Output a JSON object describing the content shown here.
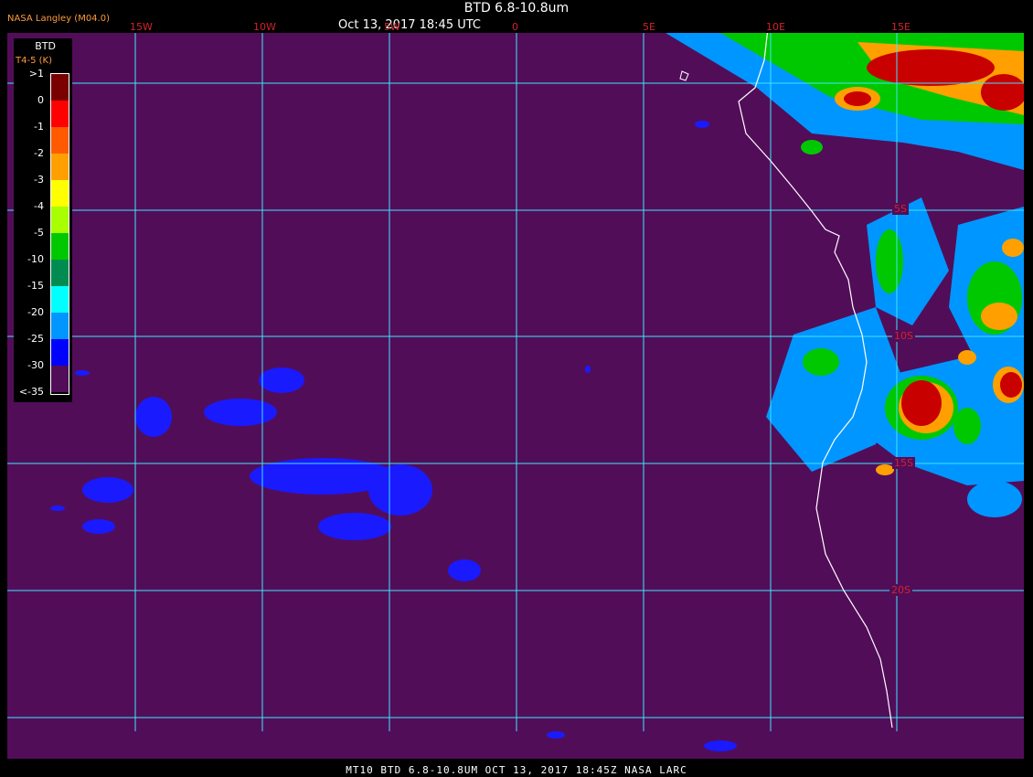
{
  "header": {
    "title": "BTD 6.8-10.8um",
    "datetime": "Oct 13, 2017 18:45 UTC",
    "organization": "NASA Langley (M04.0)"
  },
  "footer": {
    "caption": "MT10  BTD 6.8-10.8UM  OCT 13, 2017 18:45Z  NASA LARC"
  },
  "legend": {
    "title": "BTD",
    "subtitle": "T4-5 (K)",
    "ticks": [
      ">1",
      "0",
      "-1",
      "-2",
      "-3",
      "-4",
      "-5",
      "-10",
      "-15",
      "-20",
      "-25",
      "-30",
      "<-35"
    ],
    "colors": [
      "#7a0000",
      "#ff0000",
      "#ff5a00",
      "#ffa000",
      "#ffff00",
      "#a8ff00",
      "#00c800",
      "#008c50",
      "#00ffff",
      "#0096ff",
      "#0000ff",
      "#520d59"
    ]
  },
  "map": {
    "background_color": "#520d59",
    "grid_color": "#3ce6ff",
    "coastline_color": "#ffffff",
    "longitude_labels": [
      "15W",
      "10W",
      "5W",
      "0",
      "5E",
      "10E",
      "15E"
    ],
    "latitude_labels": [
      "5S",
      "10S",
      "15S",
      "20S"
    ]
  }
}
